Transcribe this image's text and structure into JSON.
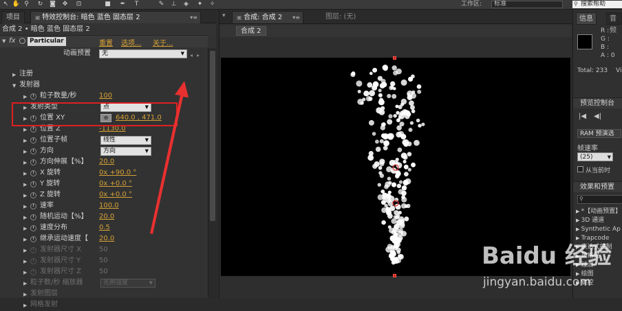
{
  "toolbar": {
    "workspace_label": "工作区:",
    "workspace_value": "标准",
    "search_text": "搜索帮助",
    "icons": [
      "selection-tool",
      "hand-tool",
      "zoom-tool",
      "rotate-tool",
      "camera-tool",
      "pan-tool",
      "rect-tool",
      "pen-tool",
      "text-tool",
      "brush-tool",
      "stamp-tool",
      "eraser-tool",
      "roto-tool",
      "puppet-tool"
    ]
  },
  "left_panel": {
    "tabs": [
      "项目",
      "特效控制台: 暗色 蓝色 固态层 2"
    ],
    "subtitle": "合成 2 • 暗色 蓝色 固态层 2",
    "effect_name": "Particular",
    "effect_links": [
      "重置",
      "选项...",
      "关于..."
    ],
    "preset_label": "动画预置",
    "preset_value": "无",
    "rows": [
      {
        "label": "注册",
        "indent": 1,
        "type": "group"
      },
      {
        "label": "发射器",
        "indent": 1,
        "type": "group-open"
      },
      {
        "label": "粒子数量/秒",
        "indent": 2,
        "value": "100",
        "stopwatch": true
      },
      {
        "label": "发射类型",
        "indent": 2,
        "dropdown": "点"
      },
      {
        "label": "位置 XY",
        "indent": 2,
        "value": "640.0 , 471.0",
        "stopwatch": true,
        "crosshair": true
      },
      {
        "label": "位置 Z",
        "indent": 2,
        "value": "-1130.0",
        "stopwatch": true
      },
      {
        "label": "位置子帧",
        "indent": 2,
        "dropdown": "线性",
        "stopwatch": true
      },
      {
        "label": "方向",
        "indent": 2,
        "dropdown": "方向",
        "stopwatch": true
      },
      {
        "label": "方向伸展【%】",
        "indent": 2,
        "value": "20.0",
        "stopwatch": true
      },
      {
        "label": "X 旋转",
        "indent": 2,
        "value": "0x +90.0 °",
        "stopwatch": true
      },
      {
        "label": "Y 旋转",
        "indent": 2,
        "value": "0x +0.0 °",
        "stopwatch": true
      },
      {
        "label": "Z 旋转",
        "indent": 2,
        "value": "0x +0.0 °",
        "stopwatch": true
      },
      {
        "label": "速率",
        "indent": 2,
        "value": "100.0",
        "stopwatch": true
      },
      {
        "label": "随机运动【%】",
        "indent": 2,
        "value": "20.0",
        "stopwatch": true
      },
      {
        "label": "速度分布",
        "indent": 2,
        "value": "0.5",
        "stopwatch": true
      },
      {
        "label": "继承运动速度【",
        "indent": 2,
        "value": "20.0",
        "stopwatch": true
      },
      {
        "label": "发射器尺寸 X",
        "indent": 2,
        "value": "50",
        "stopwatch": true,
        "dim": true
      },
      {
        "label": "发射器尺寸 Y",
        "indent": 2,
        "value": "50",
        "stopwatch": true,
        "dim": true
      },
      {
        "label": "发射器尺寸 Z",
        "indent": 2,
        "value": "50",
        "stopwatch": true,
        "dim": true
      },
      {
        "label": "粒子数/秒 缩放器",
        "indent": 2,
        "dropdown": "光照强度",
        "dim": true
      },
      {
        "label": "发射图层",
        "indent": 2,
        "type": "group",
        "dim": true
      },
      {
        "label": "网格发射",
        "indent": 2,
        "type": "group",
        "dim": true
      }
    ]
  },
  "mid_panel": {
    "tabs": [
      "合成: 合成 2",
      "图层: (无)"
    ],
    "comp_chip": "合成 2"
  },
  "right_panel": {
    "tabs": [
      "信息",
      "音频"
    ],
    "info_rgba": [
      "R :",
      "G :",
      "B :",
      "A : 0"
    ],
    "total": "Total: 233",
    "total_suffix": "Vi",
    "preview_title": "预览控制台",
    "ram_button": "RAM 预演选",
    "frame_rate_label": "帧速率",
    "frame_rate_value": "(25)",
    "from_current": "从当前时",
    "effects_title": "效果和预置",
    "effects_items": [
      "*【动画预置】",
      "3D 通道",
      "Synthetic Ap",
      "Trapcode",
      "表达式控制",
      "风格化",
      "过渡",
      "绘图",
      "键控"
    ]
  },
  "watermark": {
    "brand": "Baidu 经验",
    "url": "jingyan.baidu.com"
  },
  "colors": {
    "value_orange": "#d8a235",
    "highlight_red": "#e02020"
  }
}
